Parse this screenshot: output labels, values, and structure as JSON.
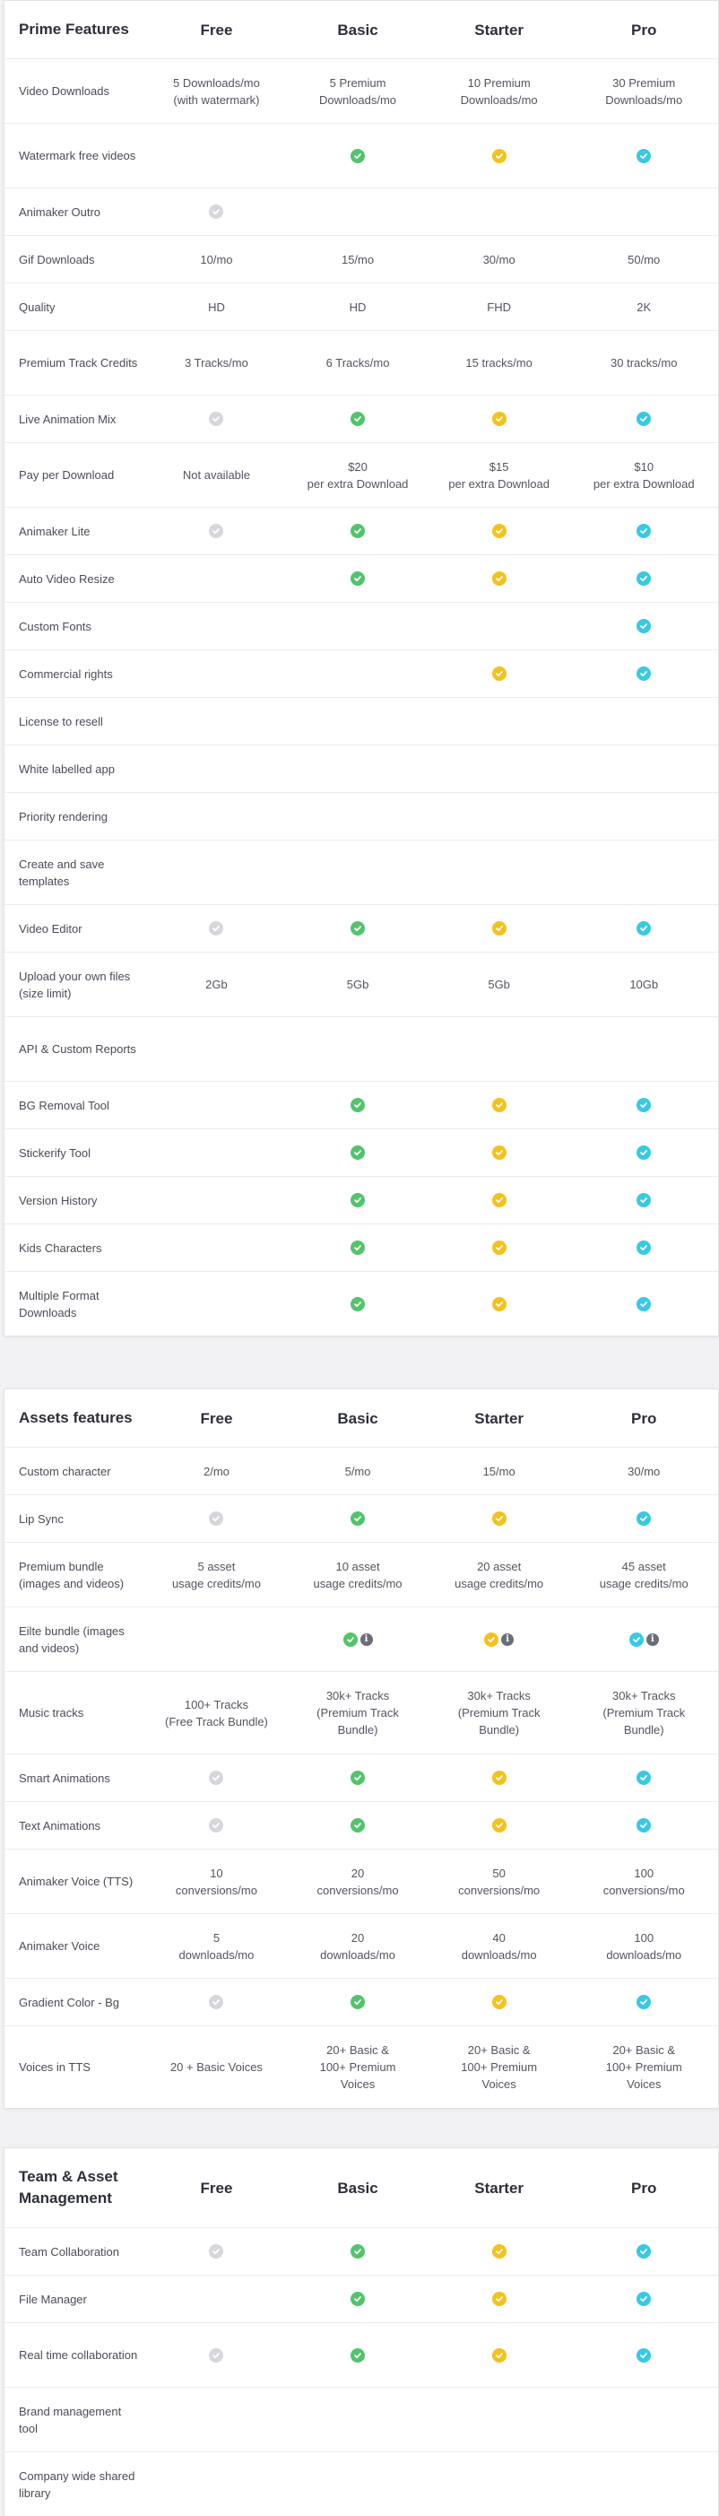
{
  "colors": {
    "free": "#d6d7db",
    "basic": "#52c46b",
    "starter": "#f4c21c",
    "pro": "#38c9e4"
  },
  "plans": [
    "Free",
    "Basic",
    "Starter",
    "Pro"
  ],
  "sections": [
    {
      "title": "Prime Features",
      "rows": [
        {
          "label": "Video Downloads",
          "cells": [
            "5 Downloads/mo\n(with watermark)",
            "5 Premium\nDownloads/mo",
            "10 Premium\nDownloads/mo",
            "30 Premium\nDownloads/mo"
          ]
        },
        {
          "label": "Watermark free videos",
          "cells": [
            "",
            "check",
            "check",
            "check"
          ]
        },
        {
          "label": "Animaker Outro",
          "cells": [
            "check",
            "",
            "",
            ""
          ]
        },
        {
          "label": "Gif Downloads",
          "cells": [
            "10/mo",
            "15/mo",
            "30/mo",
            "50/mo"
          ]
        },
        {
          "label": "Quality",
          "cells": [
            "HD",
            "HD",
            "FHD",
            "2K"
          ]
        },
        {
          "label": "Premium Track Credits",
          "cells": [
            "3 Tracks/mo",
            "6 Tracks/mo",
            "15 tracks/mo",
            "30 tracks/mo"
          ]
        },
        {
          "label": "Live Animation Mix",
          "cells": [
            "check",
            "check",
            "check",
            "check"
          ]
        },
        {
          "label": "Pay per Download",
          "cells": [
            "Not available",
            "$20\nper extra Download",
            "$15\nper extra Download",
            "$10\nper extra Download"
          ]
        },
        {
          "label": "Animaker Lite",
          "cells": [
            "check",
            "check",
            "check",
            "check"
          ]
        },
        {
          "label": "Auto Video Resize",
          "cells": [
            "",
            "check",
            "check",
            "check"
          ]
        },
        {
          "label": "Custom Fonts",
          "cells": [
            "",
            "",
            "",
            "check"
          ]
        },
        {
          "label": "Commercial rights",
          "cells": [
            "",
            "",
            "check",
            "check"
          ]
        },
        {
          "label": "License to resell",
          "cells": [
            "",
            "",
            "",
            ""
          ]
        },
        {
          "label": "White labelled app",
          "cells": [
            "",
            "",
            "",
            ""
          ]
        },
        {
          "label": "Priority rendering",
          "cells": [
            "",
            "",
            "",
            ""
          ]
        },
        {
          "label": "Create and save templates",
          "cells": [
            "",
            "",
            "",
            ""
          ]
        },
        {
          "label": "Video Editor",
          "cells": [
            "check",
            "check",
            "check",
            "check"
          ]
        },
        {
          "label": "Upload your own files (size limit)",
          "cells": [
            "2Gb",
            "5Gb",
            "5Gb",
            "10Gb"
          ]
        },
        {
          "label": "API & Custom Reports",
          "cells": [
            "",
            "",
            "",
            ""
          ]
        },
        {
          "label": "BG Removal Tool",
          "cells": [
            "",
            "check",
            "check",
            "check"
          ]
        },
        {
          "label": "Stickerify Tool",
          "cells": [
            "",
            "check",
            "check",
            "check"
          ]
        },
        {
          "label": "Version History",
          "cells": [
            "",
            "check",
            "check",
            "check"
          ]
        },
        {
          "label": "Kids Characters",
          "cells": [
            "",
            "check",
            "check",
            "check"
          ]
        },
        {
          "label": "Multiple Format Downloads",
          "cells": [
            "",
            "check",
            "check",
            "check"
          ]
        }
      ]
    },
    {
      "title": "Assets features",
      "rows": [
        {
          "label": "Custom character",
          "cells": [
            "2/mo",
            "5/mo",
            "15/mo",
            "30/mo"
          ]
        },
        {
          "label": "Lip Sync",
          "cells": [
            "check",
            "check",
            "check",
            "check"
          ]
        },
        {
          "label": "Premium bundle (images and videos)",
          "cells": [
            "5 asset\nusage credits/mo",
            "10 asset\nusage credits/mo",
            "20 asset\nusage credits/mo",
            "45 asset\nusage credits/mo"
          ]
        },
        {
          "label": "Eilte bundle (images and videos)",
          "cells": [
            "",
            "check-info",
            "check-info",
            "check-info"
          ]
        },
        {
          "label": "Music tracks",
          "cells": [
            "100+ Tracks\n(Free Track Bundle)",
            "30k+ Tracks\n(Premium Track\nBundle)",
            "30k+ Tracks\n(Premium Track\nBundle)",
            "30k+ Tracks\n(Premium Track\nBundle)"
          ]
        },
        {
          "label": "Smart Animations",
          "cells": [
            "check",
            "check",
            "check",
            "check"
          ]
        },
        {
          "label": "Text Animations",
          "cells": [
            "check",
            "check",
            "check",
            "check"
          ]
        },
        {
          "label": "Animaker Voice (TTS)",
          "cells": [
            "10\nconversions/mo",
            "20\nconversions/mo",
            "50\nconversions/mo",
            "100\nconversions/mo"
          ]
        },
        {
          "label": "Animaker Voice",
          "cells": [
            "5\ndownloads/mo",
            "20\ndownloads/mo",
            "40\ndownloads/mo",
            "100\ndownloads/mo"
          ]
        },
        {
          "label": "Gradient Color - Bg",
          "cells": [
            "check",
            "check",
            "check",
            "check"
          ]
        },
        {
          "label": "Voices in TTS",
          "cells": [
            "20 + Basic Voices",
            "20+ Basic &\n100+ Premium\nVoices",
            "20+ Basic &\n100+ Premium\nVoices",
            "20+ Basic &\n100+ Premium\nVoices"
          ]
        }
      ]
    },
    {
      "title": "Team & Asset Management",
      "rows": [
        {
          "label": "Team Collaboration",
          "cells": [
            "check",
            "check",
            "check",
            "check"
          ]
        },
        {
          "label": "File Manager",
          "cells": [
            "",
            "check",
            "check",
            "check"
          ]
        },
        {
          "label": "Real time collaboration",
          "cells": [
            "check",
            "check",
            "check",
            "check"
          ]
        },
        {
          "label": "Brand management tool",
          "cells": [
            "",
            "",
            "",
            ""
          ]
        },
        {
          "label": "Company wide shared library",
          "cells": [
            "",
            "",
            "",
            ""
          ]
        }
      ]
    }
  ]
}
